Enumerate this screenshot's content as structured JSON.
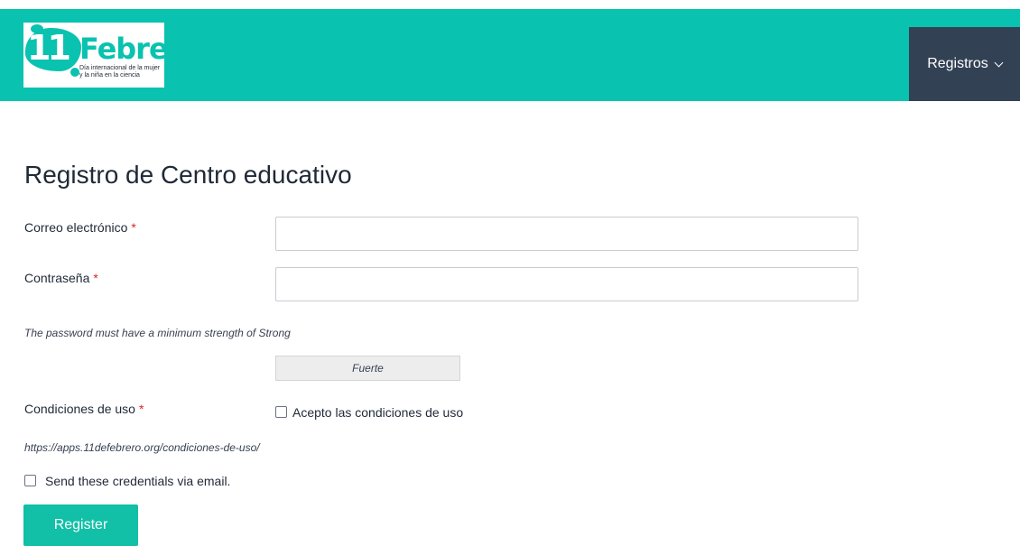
{
  "header": {
    "logo": {
      "number": "11",
      "word": "Febrero",
      "tagline": "Día internacional de la mujer\ny la niña en la ciencia"
    },
    "nav": {
      "dropdown_label": "Registros"
    }
  },
  "main": {
    "title": "Registro de Centro educativo",
    "required_marker": "*",
    "email": {
      "label": "Correo electrónico",
      "value": ""
    },
    "password": {
      "label": "Contraseña",
      "value": "",
      "hint": "The password must have a minimum strength of Strong",
      "strength_label": "Fuerte"
    },
    "terms": {
      "label": "Condiciones de uso",
      "checkbox_label": "Acepto las condiciones de uso",
      "checked": false,
      "url": "https://apps.11defebrero.org/condiciones-de-uso/"
    },
    "send_credentials": {
      "label": "Send these credentials via email.",
      "checked": false
    },
    "register_label": "Register"
  },
  "colors": {
    "header_bg": "#09c2af",
    "nav_bg": "#334155",
    "button_bg": "#12bfa7",
    "required": "#dc2626"
  },
  "icons": {
    "nav_dropdown": "chevron-down-icon"
  }
}
